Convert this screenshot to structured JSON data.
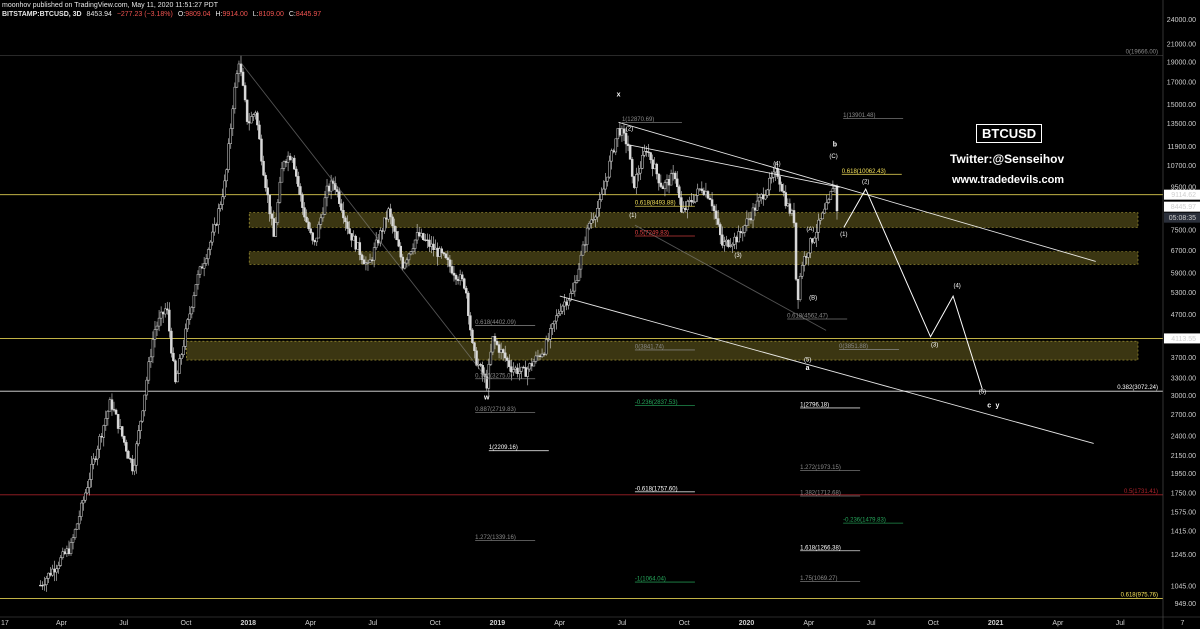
{
  "header": {
    "line1": "moonhov published on TradingView.com, May 11, 2020 11:51:27 PDT",
    "symbol": "BITSTAMP:BTCUSD, 3D",
    "last": "8453.94",
    "change": "−277.23 (−3.18%)",
    "o_label": "O:",
    "o": "9809.04",
    "h_label": "H:",
    "h": "9914.00",
    "l_label": "L:",
    "l": "8109.00",
    "c_label": "C:",
    "c": "8445.97"
  },
  "branding": {
    "ticker_box": "BTCUSD",
    "twitter": "Twitter:@Senseihov",
    "website": "www.tradedevils.com"
  },
  "colors": {
    "background": "#000000",
    "candle": "#d9d9d9",
    "zone": "#6b6320",
    "level_line": "#f5e25a",
    "red_line": "#b0232b",
    "price_badge": "#ffffff",
    "countdown_badge": "#2a2f3a",
    "fib_green": "#26a65b",
    "fib_yellow": "#f5e25a",
    "fib_red": "#e84545",
    "fib_grey": "#8a8a8a"
  },
  "chart_data": {
    "type": "candlestick",
    "interval": "3D",
    "y_scale": "log",
    "ylim": [
      900,
      24500
    ],
    "y_ticks": [
      "24000.00",
      "21000.00",
      "19000.00",
      "17000.00",
      "15000.00",
      "13500.00",
      "11900.00",
      "10700.00",
      "9500.00",
      "8445.97",
      "7500.00",
      "6700.00",
      "5900.00",
      "5300.00",
      "4700.00",
      "4113.55",
      "3700.00",
      "3300.00",
      "3000.00",
      "2700.00",
      "2400.00",
      "2150.00",
      "1950.00",
      "1750.00",
      "1575.00",
      "1415.00",
      "1245.00",
      "1045.00",
      "949.00"
    ],
    "x_ticks": [
      "Apr",
      "Jul",
      "Oct",
      "2018",
      "Apr",
      "Jul",
      "Oct",
      "2019",
      "Apr",
      "Jul",
      "Oct",
      "2020",
      "Apr",
      "Jul",
      "Oct",
      "2021",
      "Apr",
      "Jul",
      "7"
    ],
    "x_edge_label": "17",
    "price_badges": [
      {
        "value": "9114.62",
        "price": 9114.62,
        "style": "white"
      },
      {
        "value": "8445.97",
        "price": 8445.97,
        "style": "white"
      },
      {
        "value": "05:08:35",
        "price": 8000,
        "style": "dark"
      },
      {
        "value": "4113.55",
        "price": 4113.55,
        "style": "white"
      }
    ],
    "close_path": [
      [
        "2017-03-01",
        1050
      ],
      [
        "2017-04-15",
        1300
      ],
      [
        "2017-05-25",
        2300
      ],
      [
        "2017-06-12",
        2900
      ],
      [
        "2017-07-15",
        2000
      ],
      [
        "2017-08-15",
        4300
      ],
      [
        "2017-09-02",
        4900
      ],
      [
        "2017-09-15",
        3200
      ],
      [
        "2017-10-15",
        5600
      ],
      [
        "2017-11-10",
        7400
      ],
      [
        "2017-11-28",
        10000
      ],
      [
        "2017-12-08",
        15000
      ],
      [
        "2017-12-17",
        19200
      ],
      [
        "2017-12-30",
        13500
      ],
      [
        "2018-01-10",
        14500
      ],
      [
        "2018-01-20",
        11000
      ],
      [
        "2018-02-06",
        7200
      ],
      [
        "2018-02-20",
        11100
      ],
      [
        "2018-03-05",
        11400
      ],
      [
        "2018-03-20",
        8500
      ],
      [
        "2018-04-06",
        6800
      ],
      [
        "2018-04-25",
        9300
      ],
      [
        "2018-05-05",
        9800
      ],
      [
        "2018-05-28",
        7400
      ],
      [
        "2018-06-24",
        6100
      ],
      [
        "2018-07-24",
        8300
      ],
      [
        "2018-08-14",
        6200
      ],
      [
        "2018-09-05",
        7300
      ],
      [
        "2018-10-10",
        6500
      ],
      [
        "2018-11-14",
        5500
      ],
      [
        "2018-11-25",
        3800
      ],
      [
        "2018-12-15",
        3200
      ],
      [
        "2018-12-24",
        4100
      ],
      [
        "2019-01-20",
        3500
      ],
      [
        "2019-02-08",
        3400
      ],
      [
        "2019-03-10",
        3900
      ],
      [
        "2019-04-02",
        4900
      ],
      [
        "2019-04-20",
        5300
      ],
      [
        "2019-05-14",
        7800
      ],
      [
        "2019-05-30",
        8700
      ],
      [
        "2019-06-26",
        13200
      ],
      [
        "2019-07-10",
        12000
      ],
      [
        "2019-07-17",
        9500
      ],
      [
        "2019-08-06",
        11800
      ],
      [
        "2019-08-29",
        9500
      ],
      [
        "2019-09-18",
        10200
      ],
      [
        "2019-09-26",
        8200
      ],
      [
        "2019-10-26",
        9500
      ],
      [
        "2019-11-08",
        9000
      ],
      [
        "2019-11-25",
        6900
      ],
      [
        "2019-12-18",
        7200
      ],
      [
        "2020-01-14",
        8600
      ],
      [
        "2020-02-13",
        10400
      ],
      [
        "2020-02-28",
        8600
      ],
      [
        "2020-03-10",
        7900
      ],
      [
        "2020-03-13",
        4900
      ],
      [
        "2020-03-20",
        6200
      ],
      [
        "2020-04-06",
        7200
      ],
      [
        "2020-04-29",
        8700
      ],
      [
        "2020-05-07",
        9900
      ],
      [
        "2020-05-11",
        8446
      ]
    ],
    "zones": [
      {
        "from": 7600,
        "to": 8250,
        "x_start": "2018-01-01"
      },
      {
        "from": 6200,
        "to": 6650,
        "x_start": "2018-01-01"
      },
      {
        "from": 3650,
        "to": 4050,
        "x_start": "2017-10-01"
      }
    ],
    "horizontal_levels": [
      {
        "price": 19666,
        "label": "0(19666.00)",
        "color": "fib_grey"
      },
      {
        "price": 9114.62,
        "label": "",
        "color": "level_line"
      },
      {
        "price": 4113.55,
        "label": "",
        "color": "level_line"
      },
      {
        "price": 3072.24,
        "label": "0.382(3072.24)",
        "color": "white"
      },
      {
        "price": 1731.41,
        "label": "0.5(1731.41)",
        "color": "red_line"
      },
      {
        "price": 975.76,
        "label": "0.618(975.76)",
        "color": "level_line"
      }
    ],
    "fib_annotations": [
      {
        "label": "1(12870.69)",
        "date": "2019-07-01",
        "price": 13600,
        "color": "fib_grey"
      },
      {
        "label": "1(13901.48)",
        "date": "2020-05-20",
        "price": 13900,
        "color": "fib_grey"
      },
      {
        "label": "0.618(10062.43)",
        "date": "2020-05-18",
        "price": 10200,
        "color": "fib_yellow"
      },
      {
        "label": "0.618(8493.88)",
        "date": "2019-07-20",
        "price": 8550,
        "color": "fib_yellow"
      },
      {
        "label": "0.5(7249.83)",
        "date": "2019-07-20",
        "price": 7250,
        "color": "fib_red"
      },
      {
        "label": "0.618(4562.47)",
        "date": "2020-02-28",
        "price": 4580,
        "color": "fib_grey"
      },
      {
        "label": "0(3841.74)",
        "date": "2019-07-20",
        "price": 3860,
        "color": "fib_grey"
      },
      {
        "label": "0(3851.88)",
        "date": "2020-05-14",
        "price": 3870,
        "color": "fib_grey"
      },
      {
        "label": "0.618(4402.09)",
        "date": "2018-11-28",
        "price": 4420,
        "color": "fib_grey"
      },
      {
        "label": "0.786(3275.0)",
        "date": "2018-11-28",
        "price": 3290,
        "color": "fib_grey"
      },
      {
        "label": "0.887(2719.83)",
        "date": "2018-11-28",
        "price": 2730,
        "color": "fib_grey"
      },
      {
        "label": "-0.236(2837.53)",
        "date": "2019-07-20",
        "price": 2840,
        "color": "fib_green"
      },
      {
        "label": "1(2796.18)",
        "date": "2020-03-18",
        "price": 2800,
        "color": "white"
      },
      {
        "label": "1(2209.16)",
        "date": "2018-12-18",
        "price": 2210,
        "color": "white"
      },
      {
        "label": "1.272(1973.15)",
        "date": "2020-03-18",
        "price": 1980,
        "color": "fib_grey"
      },
      {
        "label": "-0.618(1757.60)",
        "date": "2019-07-20",
        "price": 1760,
        "color": "white"
      },
      {
        "label": "1.382(1712.68)",
        "date": "2020-03-18",
        "price": 1720,
        "color": "fib_grey"
      },
      {
        "label": "-0.236(1479.83)",
        "date": "2020-05-20",
        "price": 1480,
        "color": "fib_green"
      },
      {
        "label": "1.272(1339.16)",
        "date": "2018-11-28",
        "price": 1345,
        "color": "fib_grey"
      },
      {
        "label": "1.618(1266.38)",
        "date": "2020-03-18",
        "price": 1270,
        "color": "white"
      },
      {
        "label": "-1(1064.04)",
        "date": "2019-07-20",
        "price": 1068,
        "color": "fib_green"
      },
      {
        "label": "1.75(1069.27)",
        "date": "2020-03-18",
        "price": 1072,
        "color": "fib_grey"
      }
    ],
    "wave_labels": [
      {
        "label": "x",
        "date": "2019-06-26",
        "price": 15700,
        "big": true
      },
      {
        "label": "(2)",
        "date": "2019-07-12",
        "price": 13000
      },
      {
        "label": "(1)",
        "date": "2019-07-17",
        "price": 8050
      },
      {
        "label": "(3)",
        "date": "2019-12-18",
        "price": 6450
      },
      {
        "label": "(4)",
        "date": "2020-02-13",
        "price": 10700
      },
      {
        "label": "b",
        "date": "2020-05-08",
        "price": 11900,
        "big": true
      },
      {
        "label": "(C)",
        "date": "2020-05-06",
        "price": 11150
      },
      {
        "label": "(2)",
        "date": "2020-06-22",
        "price": 9700
      },
      {
        "label": "(1)",
        "date": "2020-05-21",
        "price": 7250
      },
      {
        "label": "(A)",
        "date": "2020-04-02",
        "price": 7450
      },
      {
        "label": "(B)",
        "date": "2020-04-06",
        "price": 5100
      },
      {
        "label": "(5)",
        "date": "2020-03-29",
        "price": 3620
      },
      {
        "label": "a",
        "date": "2020-03-29",
        "price": 3450,
        "big": true
      },
      {
        "label": "w",
        "date": "2018-12-15",
        "price": 2930,
        "big": true
      },
      {
        "label": "(3)",
        "date": "2020-10-01",
        "price": 3930
      },
      {
        "label": "(4)",
        "date": "2020-11-03",
        "price": 5450
      },
      {
        "label": "(5)",
        "date": "2020-12-10",
        "price": 3030
      },
      {
        "label": "c",
        "date": "2020-12-20",
        "price": 2810,
        "big": true
      },
      {
        "label": "y",
        "date": "2021-01-01",
        "price": 2810,
        "big": true
      }
    ],
    "projection_path": [
      [
        "2020-05-21",
        7600
      ],
      [
        "2020-06-22",
        9400
      ],
      [
        "2020-09-25",
        4150
      ],
      [
        "2020-10-28",
        5200
      ],
      [
        "2020-12-10",
        3100
      ]
    ],
    "trendlines": [
      {
        "from": [
          "2019-06-26",
          13600
        ],
        "to": [
          "2021-05-25",
          6300
        ],
        "color": "white"
      },
      {
        "from": [
          "2019-04-01",
          5200
        ],
        "to": [
          "2021-05-22",
          2300
        ],
        "color": "white"
      },
      {
        "from": [
          "2019-07-12",
          12000
        ],
        "to": [
          "2020-05-15",
          9500
        ],
        "color": "white"
      },
      {
        "from": [
          "2019-07-20",
          7700
        ],
        "to": [
          "2020-04-25",
          4300
        ],
        "color": "fib_grey"
      },
      {
        "from": [
          "2017-12-20",
          18900
        ],
        "to": [
          "2018-12-15",
          3300
        ],
        "color": "fib_grey"
      }
    ]
  }
}
